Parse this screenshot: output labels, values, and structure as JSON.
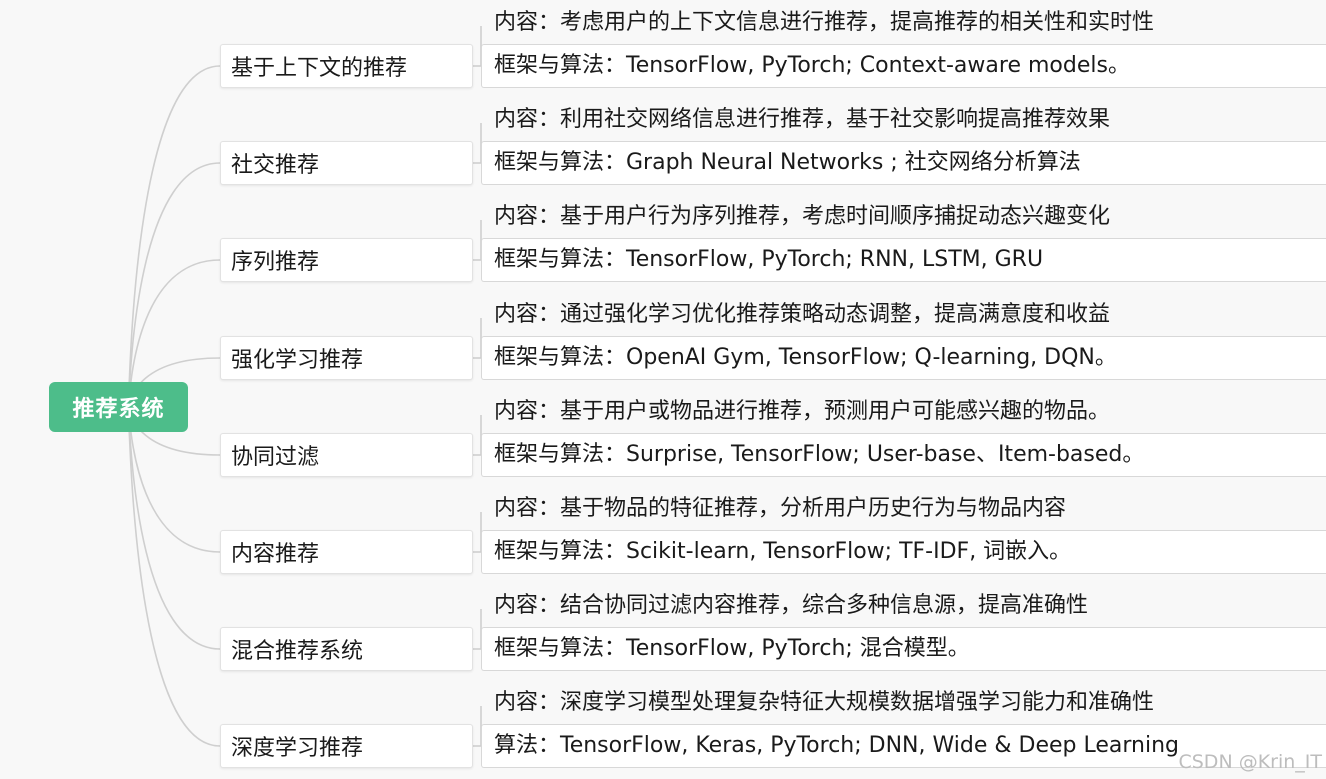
{
  "root": "推荐系统",
  "branches": [
    {
      "topic": "基于上下文的推荐",
      "content": "内容：考虑用户的上下文信息进行推荐，提高推荐的相关性和实时性",
      "algo": "框架与算法：TensorFlow, PyTorch; Context-aware models。"
    },
    {
      "topic": "社交推荐",
      "content": "内容：利用社交网络信息进行推荐，基于社交影响提高推荐效果",
      "algo": "框架与算法：Graph Neural Networks ; 社交网络分析算法"
    },
    {
      "topic": "序列推荐",
      "content": "内容：基于用户行为序列推荐，考虑时间顺序捕捉动态兴趣变化",
      "algo": "框架与算法：TensorFlow, PyTorch; RNN, LSTM, GRU"
    },
    {
      "topic": "强化学习推荐",
      "content": "内容：通过强化学习优化推荐策略动态调整，提高满意度和收益",
      "algo": "框架与算法：OpenAI Gym, TensorFlow; Q-learning, DQN。"
    },
    {
      "topic": "协同过滤",
      "content": "内容：基于用户或物品进行推荐，预测用户可能感兴趣的物品。",
      "algo": "框架与算法：Surprise, TensorFlow; User-base、Item-based。"
    },
    {
      "topic": "内容推荐",
      "content": "内容：基于物品的特征推荐，分析用户历史行为与物品内容",
      "algo": "框架与算法：Scikit-learn, TensorFlow; TF-IDF, 词嵌入。"
    },
    {
      "topic": "混合推荐系统",
      "content": "内容：结合协同过滤内容推荐，综合多种信息源，提高准确性",
      "algo": "框架与算法：TensorFlow, PyTorch; 混合模型。"
    },
    {
      "topic": "深度学习推荐",
      "content": "内容：深度学习模型处理复杂特征大规模数据增强学习能力和准确性",
      "algo": "算法：TensorFlow, Keras, PyTorch; DNN, Wide & Deep Learning"
    }
  ],
  "watermark": "CSDN @Krin_IT"
}
